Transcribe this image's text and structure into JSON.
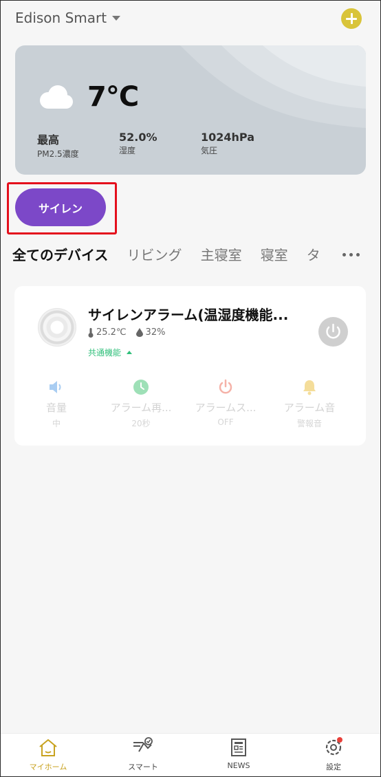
{
  "header": {
    "home_name": "Edison Smart"
  },
  "weather": {
    "temperature": "7°C",
    "stats": [
      {
        "value": "最高",
        "label": "PM2.5濃度"
      },
      {
        "value": "52.0%",
        "label": "湿度"
      },
      {
        "value": "1024hPa",
        "label": "気圧"
      }
    ]
  },
  "scene": {
    "label": "サイレン"
  },
  "tabs": [
    "全てのデバイス",
    "リビング",
    "主寝室",
    "寝室",
    "タ"
  ],
  "device": {
    "name": "サイレンアラーム(温湿度機能...",
    "temperature": "25.2℃",
    "humidity": "32%",
    "common_label": "共通機能",
    "functions": [
      {
        "label": "音量",
        "value": "中",
        "color": "#a9cdf2",
        "icon": "speaker-icon"
      },
      {
        "label": "アラーム再...",
        "value": "20秒",
        "color": "#9ee0b7",
        "icon": "clock-icon"
      },
      {
        "label": "アラームス...",
        "value": "OFF",
        "color": "#f5b2a8",
        "icon": "power-icon"
      },
      {
        "label": "アラーム音",
        "value": "警報音",
        "color": "#f4dd9a",
        "icon": "bell-icon"
      }
    ]
  },
  "nav": [
    {
      "label": "マイホーム",
      "icon": "home-icon"
    },
    {
      "label": "スマート",
      "icon": "smart-icon"
    },
    {
      "label": "NEWS",
      "icon": "news-icon"
    },
    {
      "label": "設定",
      "icon": "settings-icon"
    }
  ],
  "colors": {
    "accent": "#7c48c8",
    "highlight": "#e40f1c",
    "nav_active": "#c8a21f",
    "add_button": "#d9c43a"
  }
}
